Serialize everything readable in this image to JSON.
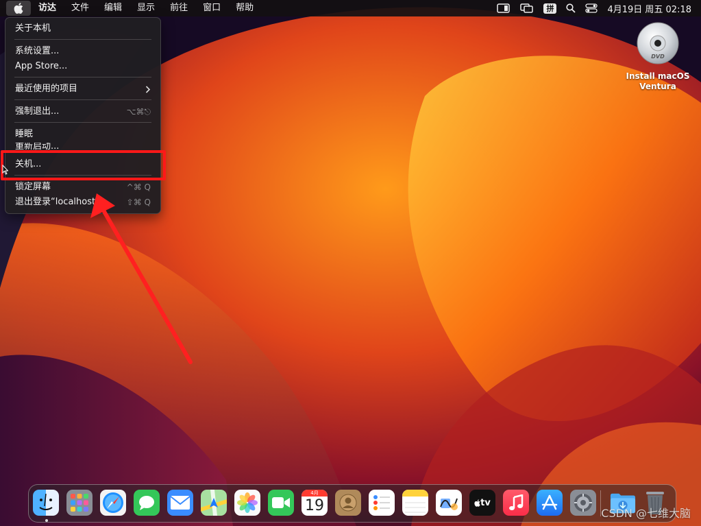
{
  "menubar": {
    "items": [
      "访达",
      "文件",
      "编辑",
      "显示",
      "前往",
      "窗口",
      "帮助"
    ],
    "input_method": "拼",
    "clock": "4月19日 周五 02:18"
  },
  "apple_menu": {
    "about": "关于本机",
    "settings": "系统设置...",
    "app_store": "App Store...",
    "recent_items": "最近使用的项目",
    "force_quit": "强制退出...",
    "force_quit_shortcut": "⌥⌘⎋",
    "sleep": "睡眠",
    "restart": "重新启动...",
    "shutdown": "关机...",
    "lock_screen": "锁定屏幕",
    "lock_shortcut": "^⌘ Q",
    "logout": "退出登录“localhost”...",
    "logout_shortcut": "⇧⌘ Q"
  },
  "desktop": {
    "install_icon_label_line1": "Install macOS",
    "install_icon_label_line2": "Ventura",
    "disc_text": "DVD"
  },
  "dock": {
    "apps": [
      "finder-icon",
      "launchpad-icon",
      "safari-icon",
      "messages-icon",
      "mail-icon",
      "maps-icon",
      "photos-icon",
      "facetime-icon",
      "calendar-icon",
      "contacts-icon",
      "reminders-icon",
      "notes-icon",
      "freeform-icon",
      "apple-tv-icon",
      "music-icon",
      "app-store-icon",
      "system-settings-icon",
      "downloads-folder-icon",
      "trash-icon"
    ],
    "calendar_month": "4月",
    "calendar_day": "19",
    "tv_label": "tv"
  },
  "watermark": "CSDN @七维大脑"
}
